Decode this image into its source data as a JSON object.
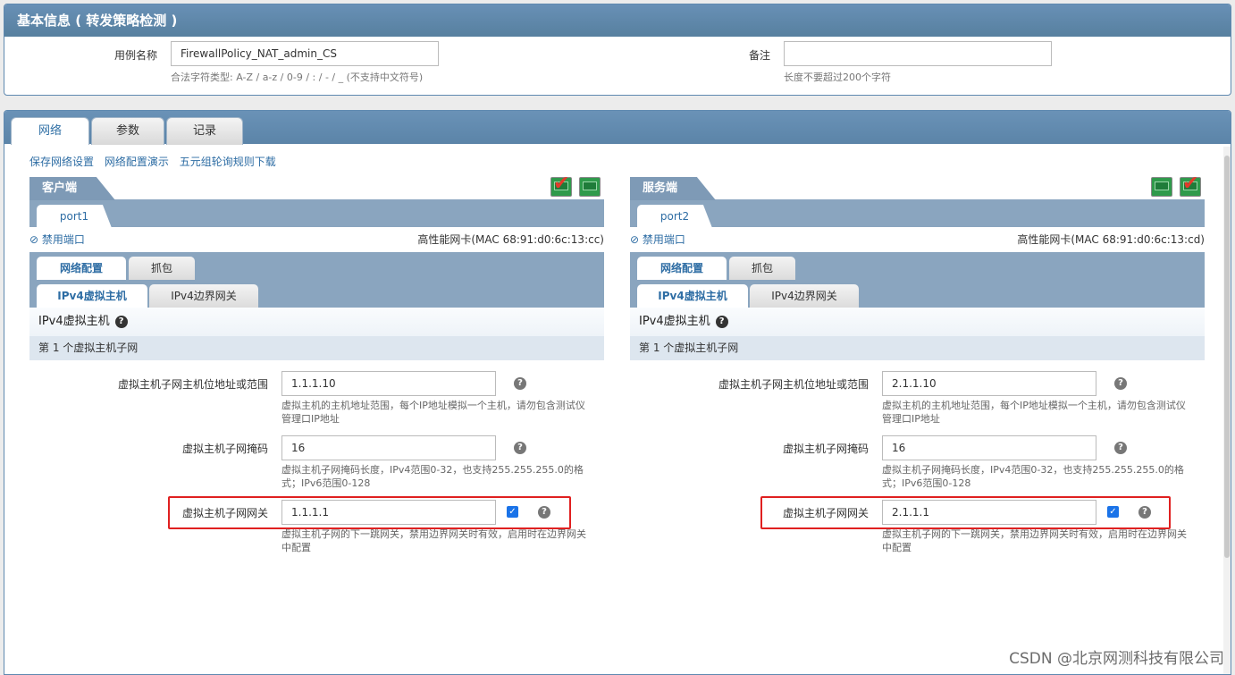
{
  "basic": {
    "title": "基本信息 ( 转发策略检测 )",
    "case_name_label": "用例名称",
    "case_name_value": "FirewallPolicy_NAT_admin_CS",
    "case_name_hint": "合法字符类型: A-Z / a-z / 0-9 / : / - / _ (不支持中文符号)",
    "note_label": "备注",
    "note_value": "",
    "note_hint": "长度不要超过200个字符"
  },
  "tabs": {
    "network": "网络",
    "params": "参数",
    "records": "记录"
  },
  "links": {
    "save": "保存网络设置",
    "demo": "网络配置演示",
    "download": "五元组轮询规则下载"
  },
  "client": {
    "title": "客户端",
    "port": "port1",
    "disable": "禁用端口",
    "mac": "高性能网卡(MAC 68:91:d0:6c:13:cc)",
    "tab_netcfg": "网络配置",
    "tab_capture": "抓包",
    "tab_ipv4host": "IPv4虚拟主机",
    "tab_ipv4gw": "IPv4边界网关",
    "section_title": "IPv4虚拟主机",
    "subnet": "第 1 个虚拟主机子网",
    "ip_label": "虚拟主机子网主机位地址或范围",
    "ip_value": "1.1.1.10",
    "ip_hint": "虚拟主机的主机地址范围，每个IP地址模拟一个主机，请勿包含测试仪管理口IP地址",
    "mask_label": "虚拟主机子网掩码",
    "mask_value": "16",
    "mask_hint": "虚拟主机子网掩码长度，IPv4范围0-32，也支持255.255.255.0的格式；IPv6范围0-128",
    "gw_label": "虚拟主机子网网关",
    "gw_value": "1.1.1.1",
    "gw_hint": "虚拟主机子网的下一跳网关，禁用边界网关时有效，启用时在边界网关中配置"
  },
  "server": {
    "title": "服务端",
    "port": "port2",
    "disable": "禁用端口",
    "mac": "高性能网卡(MAC 68:91:d0:6c:13:cd)",
    "tab_netcfg": "网络配置",
    "tab_capture": "抓包",
    "tab_ipv4host": "IPv4虚拟主机",
    "tab_ipv4gw": "IPv4边界网关",
    "section_title": "IPv4虚拟主机",
    "subnet": "第 1 个虚拟主机子网",
    "ip_label": "虚拟主机子网主机位地址或范围",
    "ip_value": "2.1.1.10",
    "ip_hint": "虚拟主机的主机地址范围，每个IP地址模拟一个主机，请勿包含测试仪管理口IP地址",
    "mask_label": "虚拟主机子网掩码",
    "mask_value": "16",
    "mask_hint": "虚拟主机子网掩码长度，IPv4范围0-32，也支持255.255.255.0的格式；IPv6范围0-128",
    "gw_label": "虚拟主机子网网关",
    "gw_value": "2.1.1.1",
    "gw_hint": "虚拟主机子网的下一跳网关，禁用边界网关时有效，启用时在边界网关中配置"
  },
  "watermark": "CSDN @北京网测科技有限公司"
}
